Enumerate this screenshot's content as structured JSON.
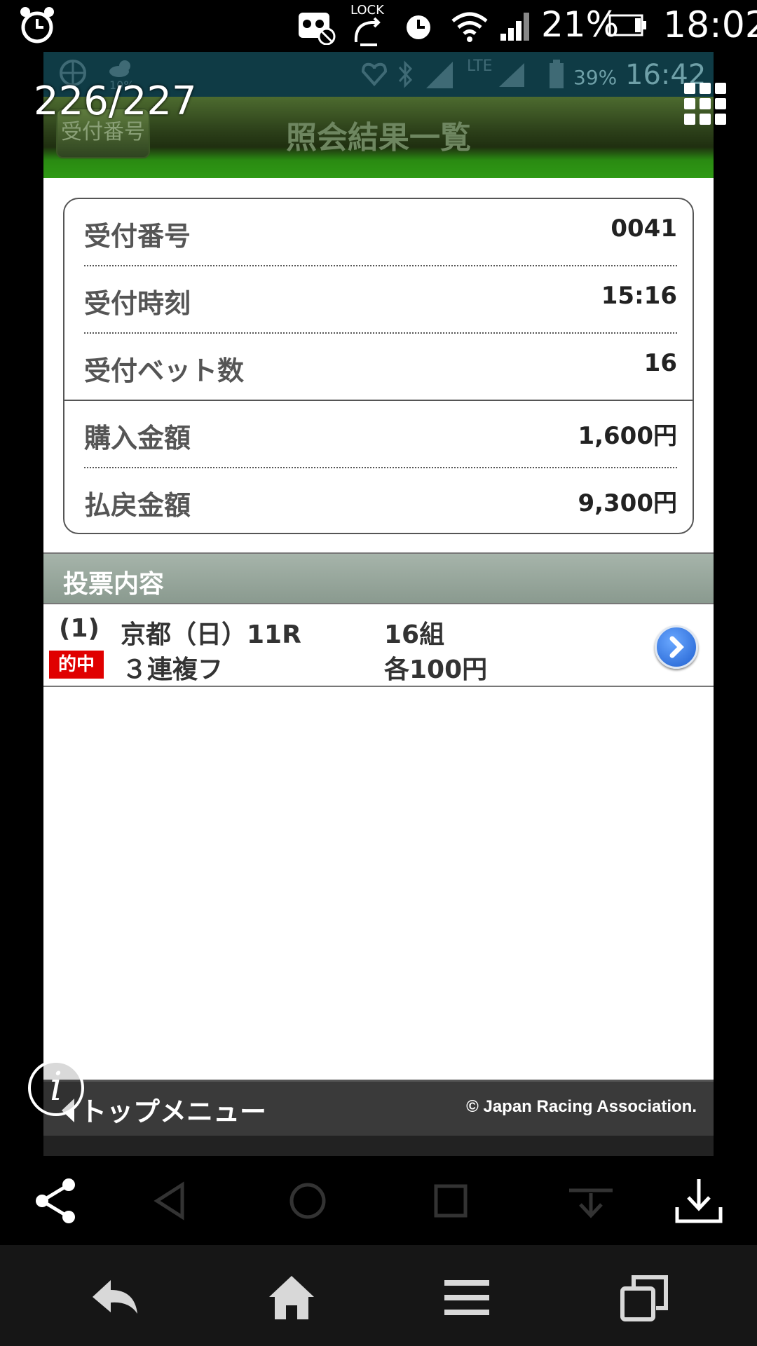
{
  "outer_status": {
    "battery_percent": "21%",
    "time": "18:02",
    "lock_label": "LOCK"
  },
  "inner_status": {
    "weather_percent": "10%",
    "network_label": "LTE",
    "battery_percent": "39%",
    "time": "16:42"
  },
  "viewer": {
    "page_counter": "226/227"
  },
  "header": {
    "back_label": "受付番号",
    "title": "照会結果一覧"
  },
  "receipt": {
    "rows": [
      {
        "label": "受付番号",
        "value": "0041"
      },
      {
        "label": "受付時刻",
        "value": "15:16"
      },
      {
        "label": "受付ベット数",
        "value": "16"
      },
      {
        "label": "購入金額",
        "value": "1,600円"
      },
      {
        "label": "払戻金額",
        "value": "9,300円"
      }
    ]
  },
  "bets": {
    "section_title": "投票内容",
    "items": [
      {
        "index": "(1)",
        "race": "京都（日）11R",
        "combos": "16組",
        "hit_badge": "的中",
        "bet_type": "３連複フ",
        "unit": "各100円"
      }
    ]
  },
  "footer": {
    "top_menu": "トップメニュー",
    "copyright": "© Japan Racing Association."
  }
}
